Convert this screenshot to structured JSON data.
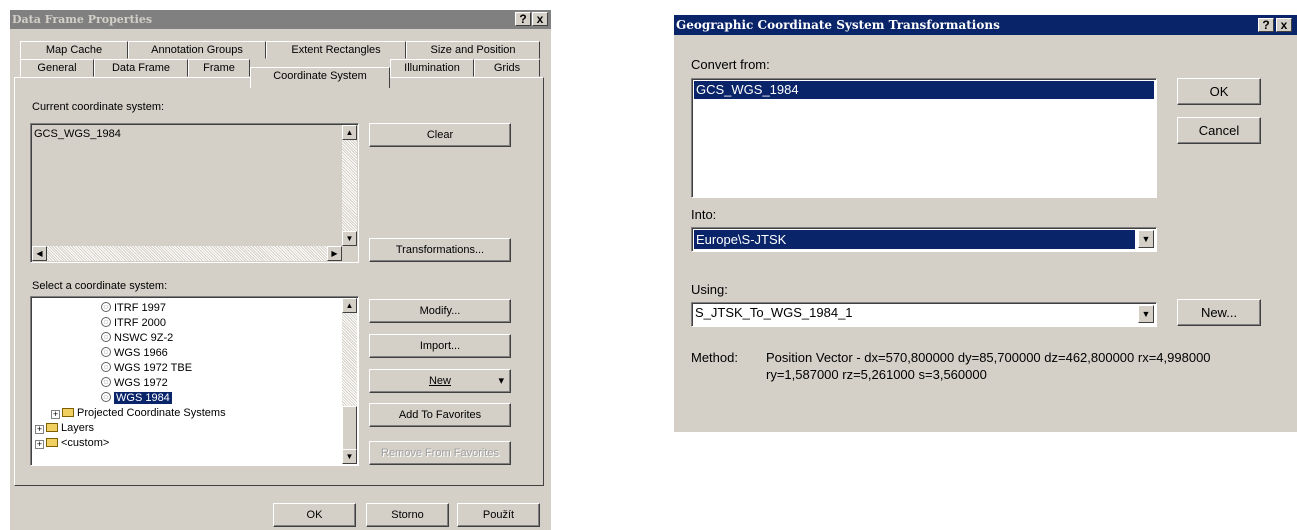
{
  "left_dialog": {
    "title": "Data Frame Properties",
    "help_btn": "?",
    "close_btn": "x",
    "tabs_row1": [
      "Map Cache",
      "Annotation Groups",
      "Extent Rectangles",
      "Size and Position"
    ],
    "tabs_row2": [
      "General",
      "Data Frame",
      "Frame",
      "Coordinate System",
      "Illumination",
      "Grids"
    ],
    "active_tab": "Coordinate System",
    "current_label": "Current coordinate system:",
    "current_value": "GCS_WGS_1984",
    "clear": "Clear",
    "transformations": "Transformations...",
    "select_label": "Select a coordinate system:",
    "tree": [
      {
        "label": "ITRF 1997",
        "selected": false
      },
      {
        "label": "ITRF 2000",
        "selected": false
      },
      {
        "label": "NSWC 9Z-2",
        "selected": false
      },
      {
        "label": "WGS 1966",
        "selected": false
      },
      {
        "label": "WGS 1972 TBE",
        "selected": false
      },
      {
        "label": "WGS 1972",
        "selected": false
      },
      {
        "label": "WGS 1984",
        "selected": true
      }
    ],
    "folders": [
      "Projected Coordinate Systems",
      "Layers",
      "<custom>"
    ],
    "modify": "Modify...",
    "import": "Import...",
    "new": "New",
    "new_arrow": "▾",
    "add_fav": "Add To Favorites",
    "remove_fav": "Remove From Favorites",
    "ok": "OK",
    "storno": "Storno",
    "apply": "Použít"
  },
  "right_dialog": {
    "title": "Geographic Coordinate System Transformations",
    "help_btn": "?",
    "close_btn": "x",
    "convert_from_label": "Convert from:",
    "convert_from_items": [
      "GCS_WGS_1984"
    ],
    "into_label": "Into:",
    "into_value": "Europe\\S-JTSK",
    "using_label": "Using:",
    "using_value": "S_JTSK_To_WGS_1984_1",
    "ok": "OK",
    "cancel": "Cancel",
    "new": "New...",
    "method_label": "Method:",
    "method_line1": "Position Vector - dx=570,800000 dy=85,700000 dz=462,800000 rx=4,998000",
    "method_line2": "ry=1,587000 rz=5,261000 s=3,560000"
  },
  "colors": {
    "face": "#d4d0c8",
    "title_inactive": "#808080",
    "title_active": "#0a246a",
    "selection": "#0a246a"
  }
}
